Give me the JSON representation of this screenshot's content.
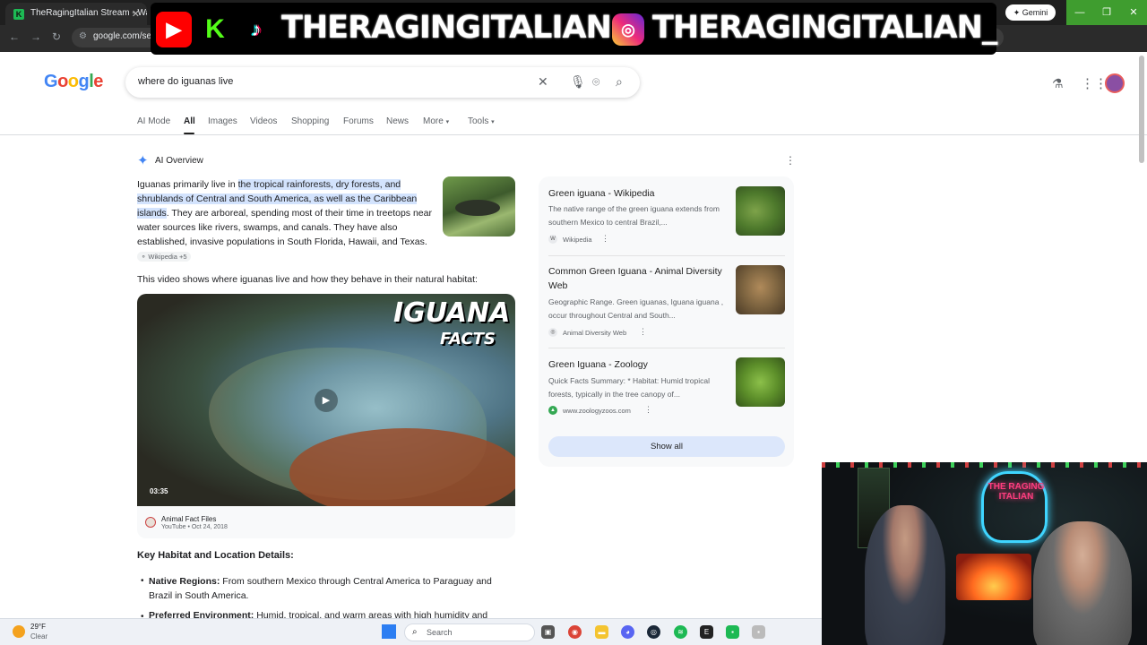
{
  "browser": {
    "tabs": [
      {
        "title": "TheRagingItalian Stream - Wat"
      }
    ],
    "url": "google.com/search",
    "gemini_label": "Gemini"
  },
  "overlay": {
    "handle_1": "THERAGINGITALIAN",
    "handle_2": "THERAGINGITALIAN_"
  },
  "google": {
    "logo": "Google",
    "query": "where do iguanas live",
    "nav_tabs": [
      "AI Mode",
      "All",
      "Images",
      "Videos",
      "Shopping",
      "Forums",
      "News",
      "More",
      "Tools"
    ],
    "active_tab": "All"
  },
  "ai_overview": {
    "label": "AI Overview",
    "para1_lead": "Iguanas primarily live in ",
    "para1_highlight": "the tropical rainforests, dry forests, and shrublands of Central and South America, as well as the Caribbean islands",
    "para1_rest": ". They are arboreal, spending most of their time in treetops near water sources like rivers, swamps, and canals. They have also established, invasive populations in South Florida, Hawaii, and Texas.",
    "cite_chip": "Wikipedia +5",
    "para2": "This video shows where iguanas live and how they behave in their natural habitat:",
    "video": {
      "title_line1": "IGUANA",
      "title_line2": "FACTS",
      "duration": "03:35",
      "channel": "Animal Fact Files",
      "meta": "YouTube • Oct 24, 2018"
    },
    "key_heading": "Key Habitat and Location Details:",
    "bullet1_bold": "Native Regions:",
    "bullet1_text": " From southern Mexico through Central America to Paraguay and Brazil in South America.",
    "bullet2_bold": "Preferred Environment:",
    "bullet2_text": " Humid, tropical, and warm areas with high humidity and"
  },
  "sources": {
    "items": [
      {
        "title": "Green iguana - Wikipedia",
        "snippet": "The native range of the green iguana extends from southern Mexico to central Brazil,...",
        "site": "Wikipedia"
      },
      {
        "title": "Common Green Iguana - Animal Diversity Web",
        "snippet": "Geographic Range. Green iguanas, Iguana iguana , occur throughout Central and South...",
        "site": "Animal Diversity Web"
      },
      {
        "title": "Green Iguana - Zoology",
        "snippet": "Quick Facts Summary: * Habitat: Humid tropical forests, typically in the tree canopy of...",
        "site": "www.zoologyzoos.com"
      }
    ],
    "show_all": "Show all"
  },
  "webcam": {
    "neon_text": "THE RAGING ITALIAN"
  },
  "taskbar": {
    "temp": "29°F",
    "condition": "Clear",
    "search_placeholder": "Search"
  },
  "colors": {
    "accent_blue": "#1a73e8",
    "highlight": "#d3e3fd",
    "window_ctl_green": "#3f9d2f"
  }
}
